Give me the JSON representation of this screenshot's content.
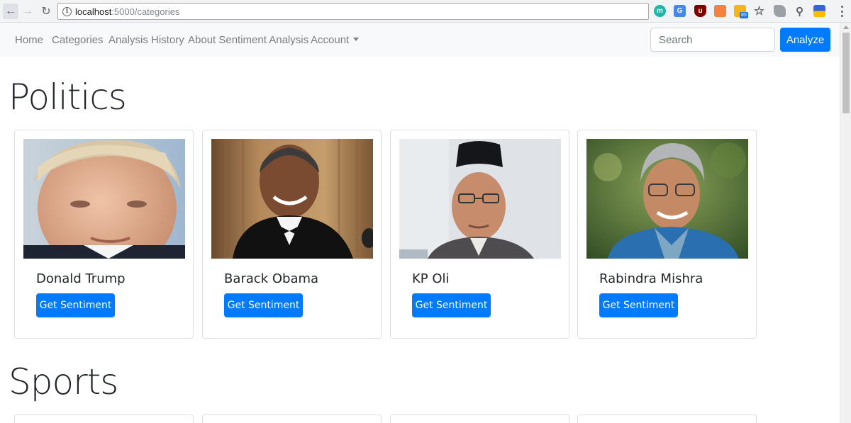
{
  "browser": {
    "url_host": "localhost",
    "url_path": ":5000/categories",
    "info_glyph": "i",
    "extension_badge": "85"
  },
  "navbar": {
    "links": [
      "Home",
      "Categories",
      "Analysis History",
      "About Sentiment Analysis"
    ],
    "account_label": "Account",
    "search_placeholder": "Search",
    "analyze_label": "Analyze"
  },
  "sections": [
    {
      "title": "Politics",
      "cards": [
        {
          "name": "Donald Trump",
          "button": "Get Sentiment"
        },
        {
          "name": "Barack Obama",
          "button": "Get Sentiment"
        },
        {
          "name": "KP Oli",
          "button": "Get Sentiment"
        },
        {
          "name": "Rabindra Mishra",
          "button": "Get Sentiment"
        }
      ]
    },
    {
      "title": "Sports"
    }
  ],
  "colors": {
    "primary": "#007bff",
    "navbar_bg": "#f8f9fa",
    "nav_link": "#7a7d80"
  }
}
